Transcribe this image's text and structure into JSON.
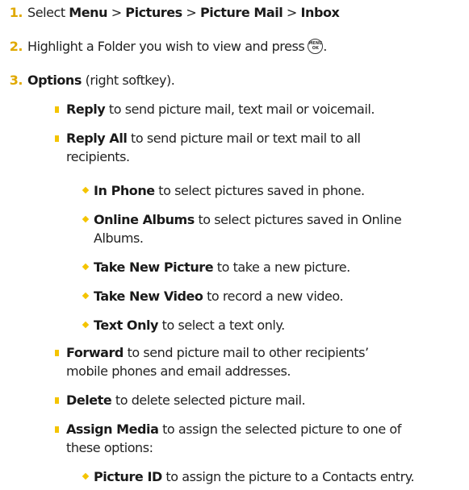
{
  "steps": [
    {
      "number": "1.",
      "parts": [
        "Select ",
        "Menu",
        " > ",
        "Pictures",
        " > ",
        "Picture Mail",
        " > ",
        "Inbox"
      ]
    },
    {
      "number": "2.",
      "text": "Highlight a Folder you wish to view and press",
      "end": ".",
      "key_icon": "menu-ok-key-icon",
      "key_text_top": "MENU",
      "key_text_bottom": "OK"
    },
    {
      "number": "3.",
      "bold": "Options",
      "rest": " (right softkey)."
    }
  ],
  "options": {
    "reply": {
      "bold": "Reply",
      "rest": " to send picture mail, text mail or voicemail."
    },
    "reply_all": {
      "bold": "Reply All",
      "rest": " to send picture mail or text mail to all",
      "cont": "recipients."
    },
    "sub_items": {
      "in_phone": {
        "bold": "In Phone",
        "rest": " to select pictures saved in phone."
      },
      "online_albums": {
        "bold": "Online Albums",
        "rest": " to select pictures saved in Online",
        "cont": "Albums."
      },
      "take_new_picture": {
        "bold": "Take New Picture",
        "rest": " to take a new picture."
      },
      "take_new_video": {
        "bold": "Take New Video",
        "rest": " to record a new video."
      },
      "text_only": {
        "bold": "Text Only",
        "rest": " to select a text only."
      }
    },
    "forward": {
      "bold": "Forward",
      "rest": " to send picture mail to other recipients’",
      "cont": "mobile phones and email addresses."
    },
    "delete": {
      "bold": "Delete",
      "rest": " to delete selected picture mail."
    },
    "assign_media": {
      "bold": "Assign Media",
      "rest": " to assign the selected picture to one of",
      "cont": "these options:"
    },
    "picture_id": {
      "bold": "Picture ID",
      "rest": " to assign the picture to a Contacts entry."
    }
  },
  "colors": {
    "bullet": "#f4c400",
    "number": "#e0a800",
    "text": "#222222"
  }
}
